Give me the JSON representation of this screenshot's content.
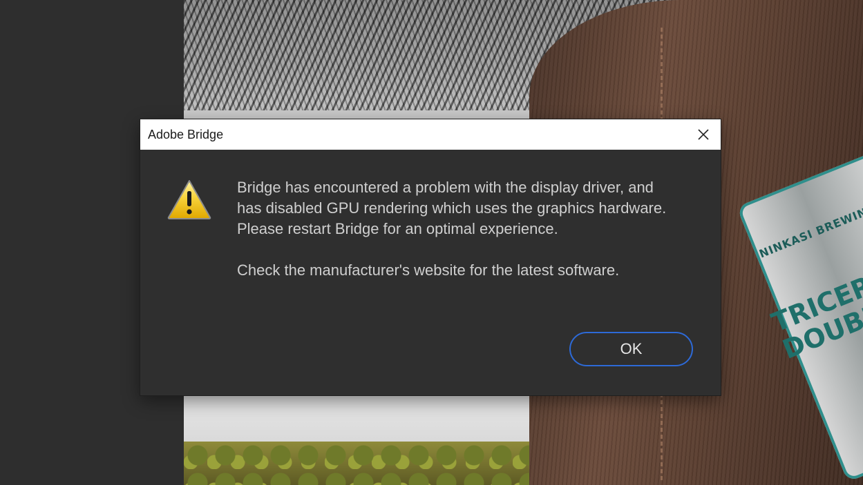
{
  "dialog": {
    "title": "Adobe Bridge",
    "close_icon": "close-icon",
    "warning_icon": "warning-icon",
    "message_lines": [
      "Bridge has encountered a problem with the display driver, and",
      "has disabled GPU rendering which uses the graphics hardware.",
      "Please restart Bridge for an optimal experience."
    ],
    "message_secondary": "Check the manufacturer's website for the latest software.",
    "ok_label": "OK"
  },
  "background": {
    "can_text_brand": "NINKASI BREWING COMPA",
    "can_text_name_1": "TRICERAHO",
    "can_text_name_2": "DOUBLE"
  },
  "colors": {
    "accent": "#2d6ad8",
    "dialog_bg": "#2f2f2f",
    "titlebar_bg": "#ffffff",
    "text": "#cfcfcf"
  }
}
